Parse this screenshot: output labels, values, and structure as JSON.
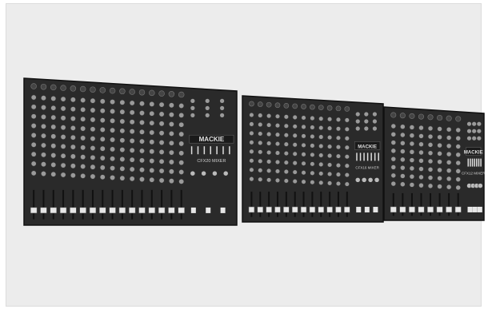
{
  "photo": {
    "description_free": true,
    "mixers": [
      {
        "logo": "MACKIE",
        "model": "CFX20 MIXER",
        "channels": 16
      },
      {
        "logo": "MACKIE",
        "model": "CFX16 MIXER",
        "channels": 12
      },
      {
        "logo": "MACKIE",
        "model": "CFX12 MIXER",
        "channels": 8
      }
    ],
    "colors": {
      "background": "#ececec",
      "chassis": "#2a2a2a",
      "knob": "#9a9a9a",
      "fader": "#e6e6e6"
    }
  }
}
